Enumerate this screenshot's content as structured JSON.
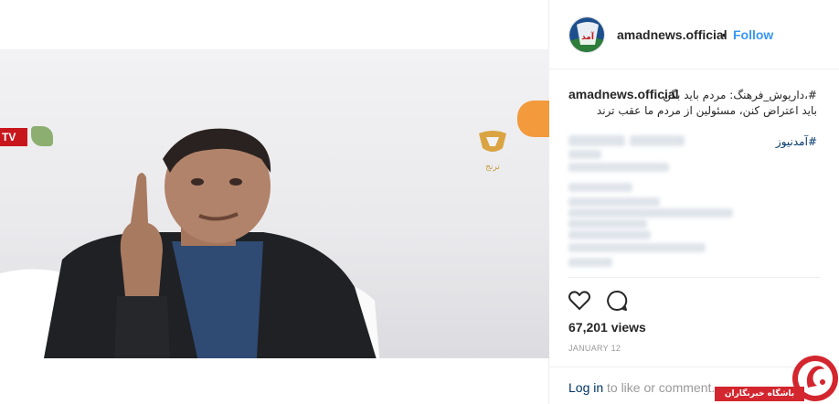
{
  "video": {
    "channel_badge": "TV",
    "watermark_text": "ترنج"
  },
  "post": {
    "username": "amadnews.official",
    "separator": "•",
    "follow_label": "Follow",
    "caption_user": "amadnews.official",
    "caption_line1": "داریوش_فرهنگ: مردم باید بگن،#",
    "caption_line2": "باید اعتراض کنن، مسئولین از مردم ما عقب ترند",
    "hashtag": "آمدنیوز#",
    "views": "67,201 views",
    "date": "JANUARY 12",
    "login_link": "Log in",
    "login_rest": "to like or comment."
  },
  "overlay": {
    "banner_text": "باشگاه خبرنگاران"
  },
  "colors": {
    "link_blue": "#3897f0",
    "hashtag_navy": "#003569",
    "muted": "#999999",
    "banner_red": "#d3262e"
  },
  "icons": {
    "like": "heart-outline-icon",
    "comment": "speech-bubble-icon"
  }
}
